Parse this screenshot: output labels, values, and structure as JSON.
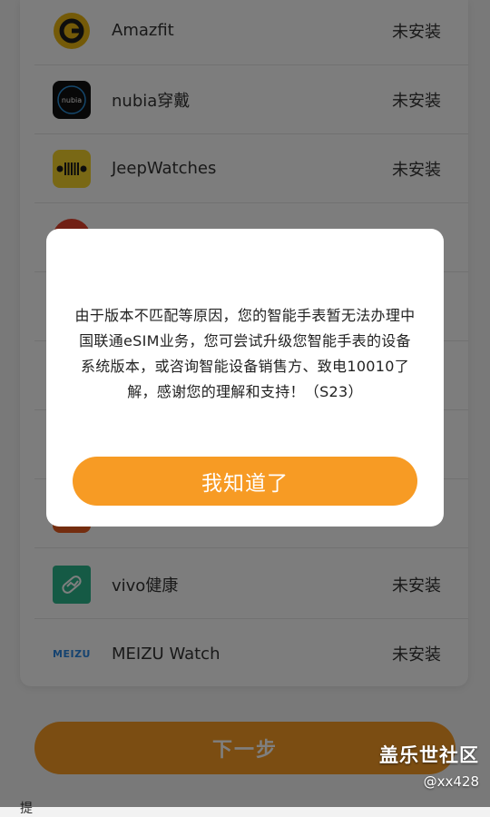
{
  "apps": [
    {
      "name": "Amazfit",
      "status": "未安装",
      "icon": "amazfit-logo-icon"
    },
    {
      "name": "nubia穿戴",
      "status": "未安装",
      "icon": "nubia-logo-icon",
      "icon_text": "nubia"
    },
    {
      "name": "JeepWatches",
      "status": "未安装",
      "icon": "jeep-grille-icon"
    },
    {
      "name": "vivo健康",
      "status": "未安装",
      "icon": "vivo-health-icon"
    },
    {
      "name": "MEIZU Watch",
      "status": "未安装",
      "icon": "meizu-logo-icon",
      "icon_text": "MEIZU"
    }
  ],
  "next_button": {
    "label": "下一步"
  },
  "bottom_partial_text": "提",
  "dialog": {
    "message": "由于版本不匹配等原因，您的智能手表暂无法办理中国联通eSIM业务，您可尝试升级您智能手表的设备系统版本，或咨询智能设备销售方、致电10010了解，感谢您的理解和支持！（S23）",
    "ok_label": "我知道了"
  },
  "watermark": {
    "title": "盖乐世社区",
    "user": "@xx428"
  },
  "colors": {
    "accent": "#f79b24",
    "overlay": "rgba(0,0,0,0.5)"
  }
}
